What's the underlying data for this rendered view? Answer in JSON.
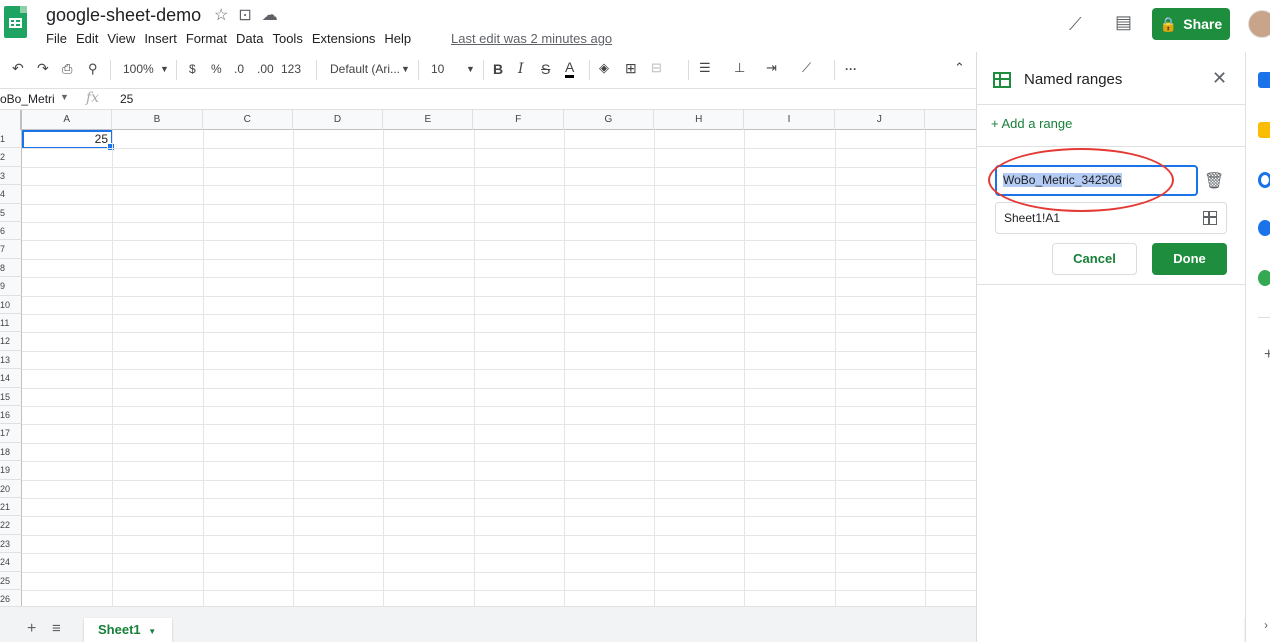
{
  "header": {
    "doc_title": "google-sheet-demo",
    "menu": [
      "File",
      "Edit",
      "View",
      "Insert",
      "Format",
      "Data",
      "Tools",
      "Extensions",
      "Help"
    ],
    "last_edit": "Last edit was 2 minutes ago",
    "share_label": "Share",
    "icons": [
      "star-icon",
      "move-folder-icon",
      "cloud-status-icon",
      "trending-icon",
      "comment-icon",
      "lock-icon"
    ]
  },
  "toolbar": {
    "zoom": "100%",
    "currency": "$",
    "percent": "%",
    "dec_decrease": ".0",
    "dec_increase": ".00",
    "more_formats": "123",
    "font": "Default (Ari...",
    "font_size": "10",
    "bold": "B",
    "italic": "I",
    "strike": "S",
    "text_color": "A",
    "more": "···"
  },
  "formula_bar": {
    "name_box": "oBo_Metri",
    "fx": "fx",
    "value": "25"
  },
  "grid": {
    "columns": [
      "A",
      "B",
      "C",
      "D",
      "E",
      "F",
      "G",
      "H",
      "I",
      "J"
    ],
    "rows": [
      "1",
      "2",
      "3",
      "4",
      "5",
      "6",
      "7",
      "8",
      "9",
      "10",
      "11",
      "12",
      "13",
      "14",
      "15",
      "16",
      "17",
      "18",
      "19",
      "20",
      "21",
      "22",
      "23",
      "24",
      "25",
      "26"
    ],
    "a1_value": "25"
  },
  "sheet_tabs": {
    "add": "+",
    "list": "≡",
    "active": "Sheet1"
  },
  "panel": {
    "title": "Named ranges",
    "add_range": "+ Add a range",
    "name_value": "WoBo_Metric_342506",
    "range_value": "Sheet1!A1",
    "cancel_label": "Cancel",
    "done_label": "Done"
  },
  "colors": {
    "brand_green": "#1e8e3e",
    "selection_blue": "#1a73e8",
    "annotation_red": "#e53935"
  }
}
